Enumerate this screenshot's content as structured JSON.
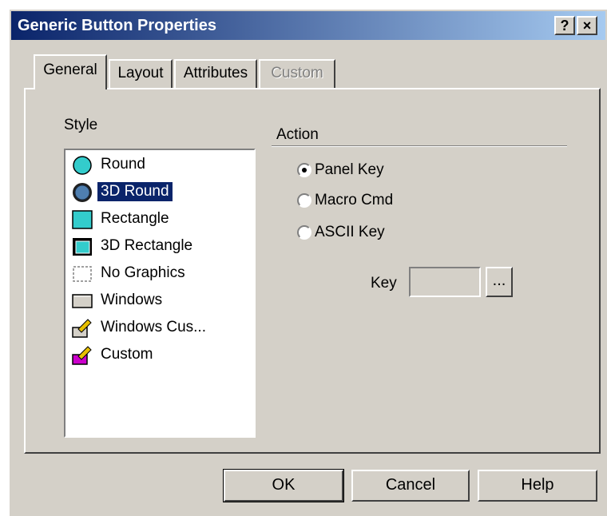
{
  "window": {
    "title": "Generic Button Properties",
    "help_button": "?",
    "close_button": "×"
  },
  "tabs": [
    {
      "label": "General",
      "state": "active"
    },
    {
      "label": "Layout",
      "state": "normal"
    },
    {
      "label": "Attributes",
      "state": "normal"
    },
    {
      "label": "Custom",
      "state": "disabled"
    }
  ],
  "style": {
    "label": "Style",
    "selected": "3D Round",
    "items": [
      {
        "label": "Round",
        "icon": "round-icon"
      },
      {
        "label": "3D Round",
        "icon": "3d-round-icon"
      },
      {
        "label": "Rectangle",
        "icon": "rectangle-icon"
      },
      {
        "label": "3D Rectangle",
        "icon": "3d-rectangle-icon"
      },
      {
        "label": "No Graphics",
        "icon": "no-graphics-icon"
      },
      {
        "label": "Windows",
        "icon": "windows-icon"
      },
      {
        "label": "Windows Cus...",
        "icon": "windows-custom-icon"
      },
      {
        "label": "Custom",
        "icon": "custom-icon"
      }
    ]
  },
  "action": {
    "label": "Action",
    "selected": "Panel Key",
    "options": [
      {
        "label": "Panel Key",
        "checked": true
      },
      {
        "label": "Macro Cmd",
        "checked": false
      },
      {
        "label": "ASCII Key",
        "checked": false
      }
    ]
  },
  "key": {
    "label": "Key",
    "value": "",
    "browse_label": "..."
  },
  "buttons": {
    "ok": "OK",
    "cancel": "Cancel",
    "help": "Help"
  },
  "colors": {
    "dialog_bg": "#d4d0c8",
    "title_start": "#0a246a",
    "title_end": "#a6caf0",
    "selection": "#0a246a",
    "icon_cyan": "#33cccc",
    "icon_magenta": "#cc00cc"
  }
}
